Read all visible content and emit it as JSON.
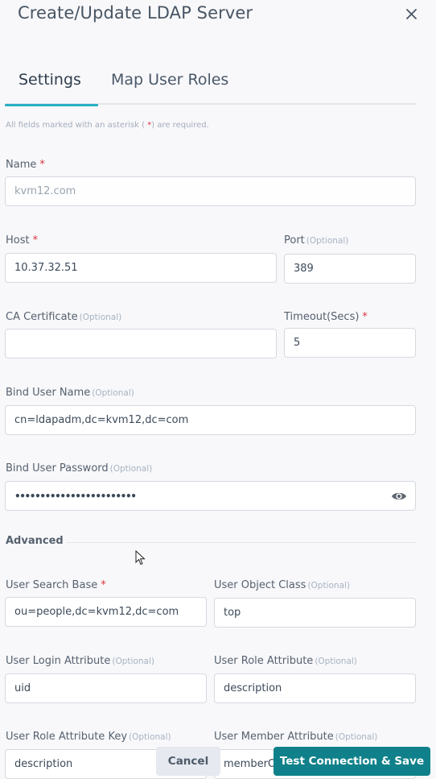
{
  "dialog": {
    "title": "Create/Update LDAP Server",
    "close_icon": "close-icon"
  },
  "tabs": [
    {
      "label": "Settings",
      "active": true
    },
    {
      "label": "Map User Roles",
      "active": false
    }
  ],
  "required_note": {
    "prefix": "All fields marked with an asterisk (",
    "asterisk": " *",
    "suffix": ") are required."
  },
  "optional_tag": "(Optional)",
  "required_mark": "*",
  "fields": {
    "name": {
      "label": "Name",
      "value": "kvm12.com",
      "required": true,
      "disabled": true
    },
    "host": {
      "label": "Host",
      "value": "10.37.32.51",
      "required": true
    },
    "port": {
      "label": "Port",
      "value": "389",
      "optional": true
    },
    "ca_certificate": {
      "label": "CA Certificate",
      "value": "",
      "optional": true
    },
    "timeout": {
      "label": "Timeout(Secs)",
      "value": "5",
      "required": true
    },
    "bind_user_name": {
      "label": "Bind User Name",
      "value": "cn=ldapadm,dc=kvm12,dc=com",
      "optional": true
    },
    "bind_user_password": {
      "label": "Bind User Password",
      "value": "••••••••••••••••••••••••",
      "optional": true,
      "toggle_icon": "eye-icon"
    },
    "user_search_base": {
      "label": "User Search Base",
      "value": "ou=people,dc=kvm12,dc=com",
      "required": true
    },
    "user_object_class": {
      "label": "User Object Class",
      "value": "top",
      "optional": true
    },
    "user_login_attribute": {
      "label": "User Login Attribute",
      "value": "uid",
      "optional": true
    },
    "user_role_attribute": {
      "label": "User Role Attribute",
      "value": "description",
      "optional": true
    },
    "user_role_attribute_key": {
      "label": "User Role Attribute Key",
      "value": "description",
      "optional": true
    },
    "user_member_attribute": {
      "label": "User Member Attribute",
      "value": "memberOf",
      "optional": true
    }
  },
  "sections": {
    "advanced": "Advanced"
  },
  "buttons": {
    "cancel": "Cancel",
    "save": "Test Connection & Save"
  },
  "colors": {
    "accent_tab": "#2ab0c3",
    "primary_button": "#10818a",
    "required_asterisk": "#d9363e"
  }
}
